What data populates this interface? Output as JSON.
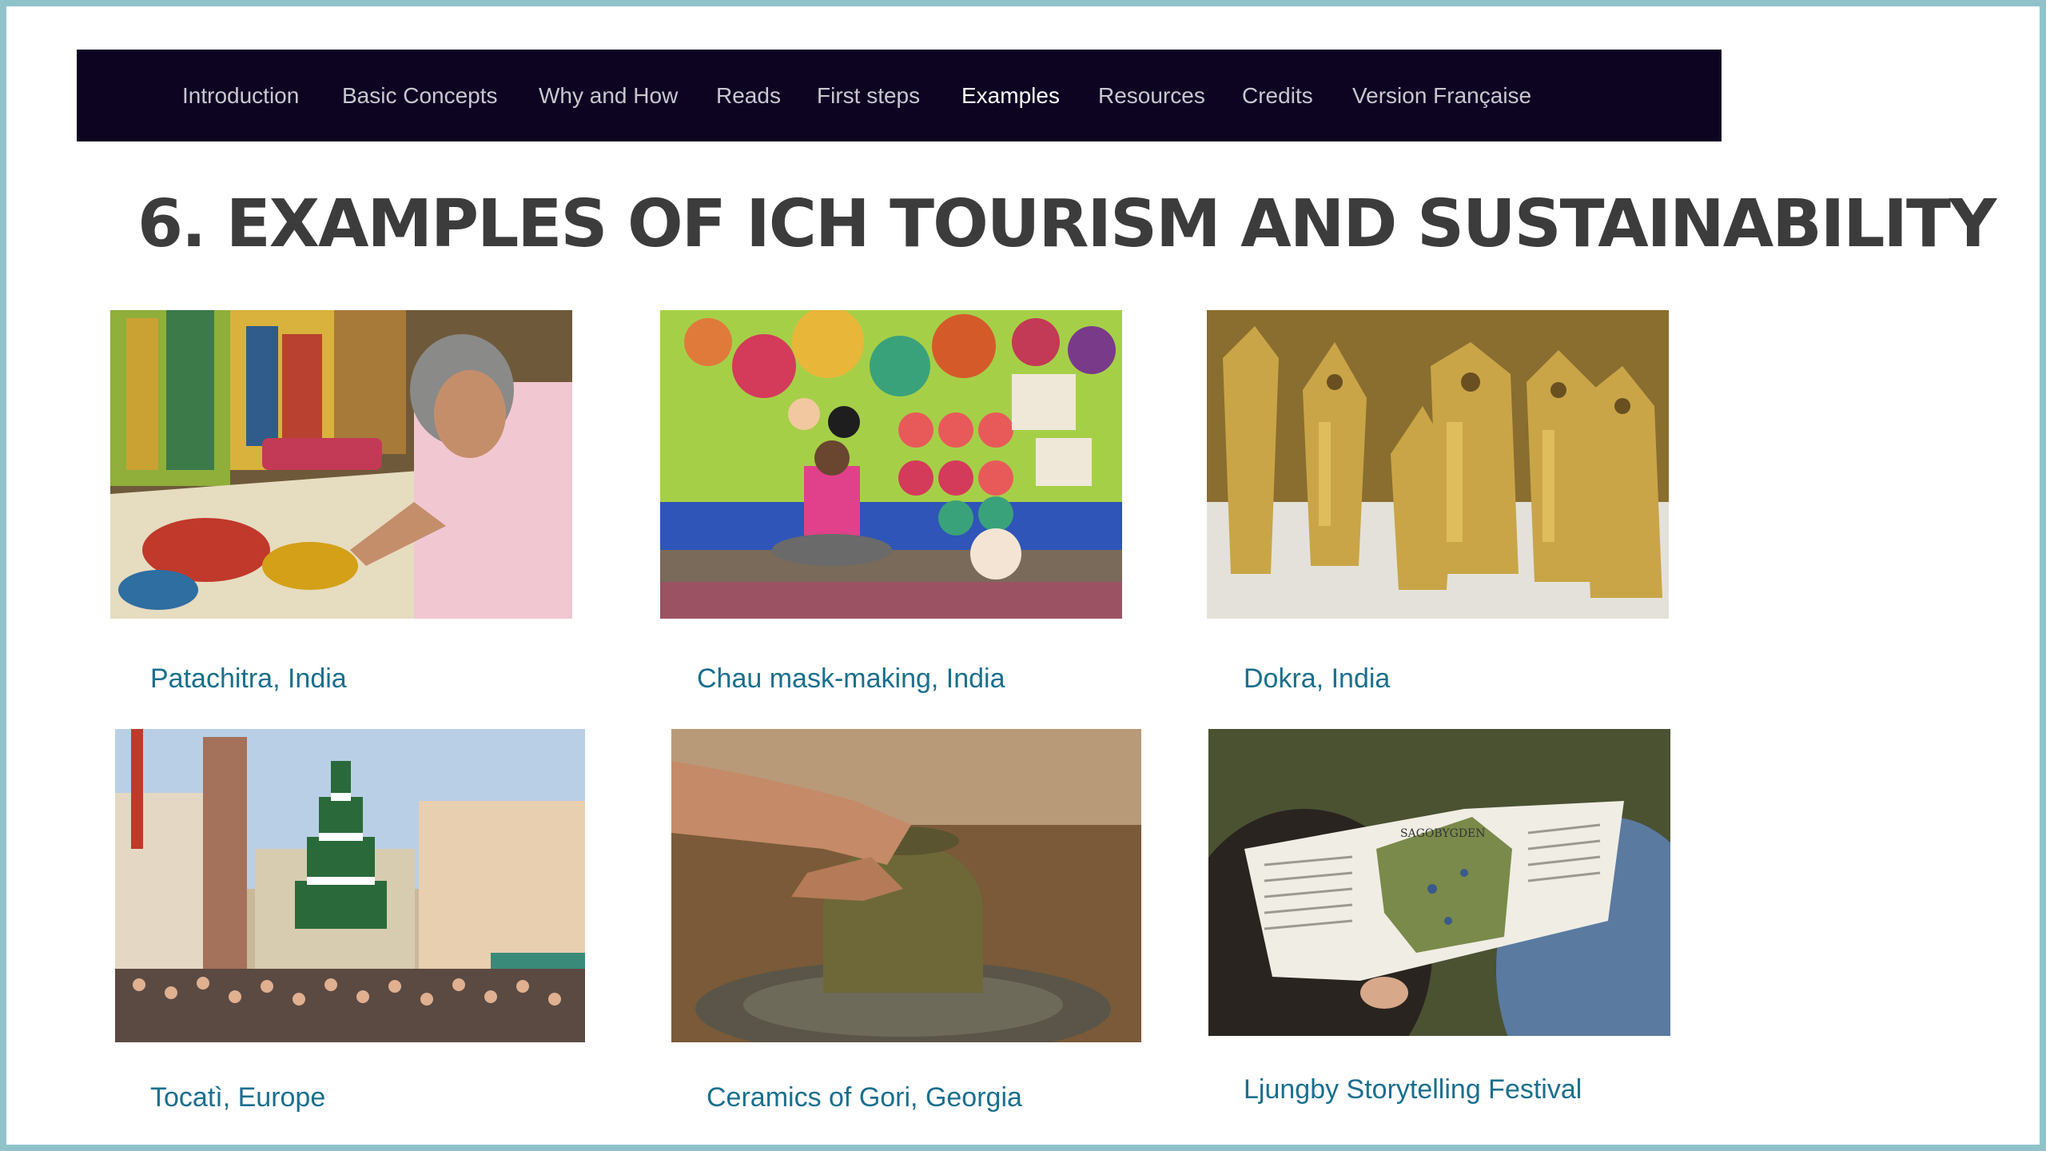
{
  "nav": {
    "items": [
      {
        "label": "Introduction",
        "active": false
      },
      {
        "label": "Basic Concepts",
        "active": false
      },
      {
        "label": "Why and How",
        "active": false
      },
      {
        "label": "Reads",
        "active": false
      },
      {
        "label": "First steps",
        "active": false
      },
      {
        "label": "Examples",
        "active": true
      },
      {
        "label": "Resources",
        "active": false
      },
      {
        "label": "Credits",
        "active": false
      },
      {
        "label": "Version Française",
        "active": false
      }
    ]
  },
  "page": {
    "title": "6. EXAMPLES OF ICH TOURISM AND SUSTAINABILITY"
  },
  "examples": [
    {
      "caption": "Patachitra, India"
    },
    {
      "caption": "Chau mask-making, India"
    },
    {
      "caption": "Dokra, India"
    },
    {
      "caption": "Tocatì, Europe"
    },
    {
      "caption": "Ceramics of Gori, Georgia"
    },
    {
      "caption": "Ljungby Storytelling Festival"
    }
  ],
  "images": {
    "map_heading": "SAGOBYGDEN"
  },
  "colors": {
    "nav_background": "#0d0422",
    "nav_text": "#c9c6d0",
    "nav_active": "#ffffff",
    "title": "#3c3c3c",
    "caption_link": "#1a6f8e",
    "frame_border": "#8fc3c9"
  }
}
